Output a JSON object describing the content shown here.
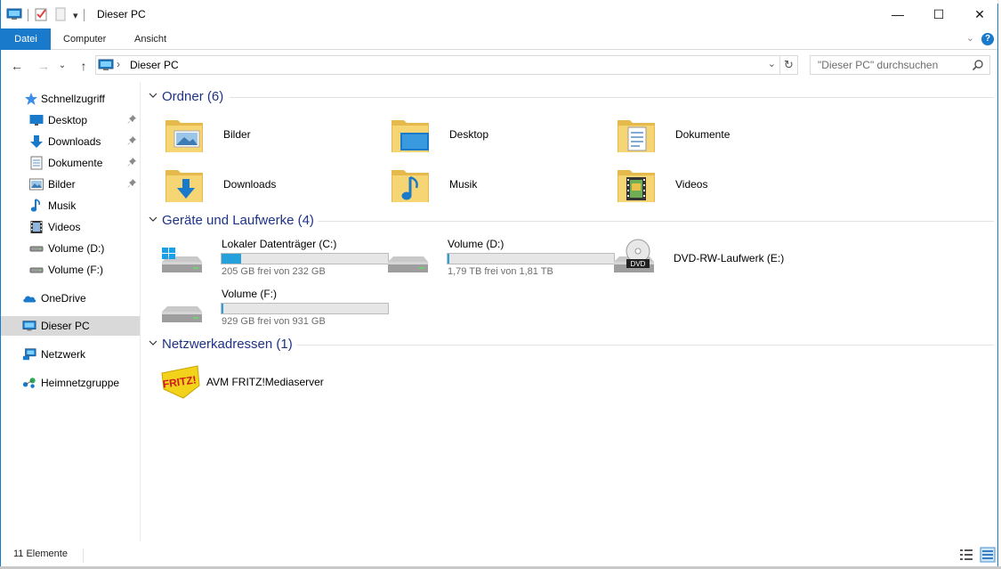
{
  "window": {
    "title": "Dieser PC",
    "minimize_glyph": "—",
    "maximize_glyph": "☐",
    "close_glyph": "✕"
  },
  "qat": {
    "dropdown_glyph": "▾",
    "icons": [
      "computer-icon",
      "properties-icon",
      "new-folder-icon",
      "customize-qat-icon"
    ]
  },
  "ribbon": {
    "tabs": [
      "Datei",
      "Computer",
      "Ansicht"
    ],
    "expand_glyph": "⌄",
    "help_glyph": "?"
  },
  "nav": {
    "back_glyph": "←",
    "forward_glyph": "→",
    "recent_glyph": "⌄",
    "up_glyph": "↑",
    "address_sep": "›",
    "address_crumb": "Dieser PC",
    "address_dropdown": "⌄",
    "refresh_glyph": "↻",
    "search_placeholder": "\"Dieser PC\" durchsuchen"
  },
  "sidebar": {
    "quick_access": "Schnellzugriff",
    "quick_items": [
      {
        "label": "Desktop",
        "icon": "desktop-icon",
        "pinned": true
      },
      {
        "label": "Downloads",
        "icon": "download-icon",
        "pinned": true
      },
      {
        "label": "Dokumente",
        "icon": "documents-icon",
        "pinned": true
      },
      {
        "label": "Bilder",
        "icon": "pictures-icon",
        "pinned": true
      },
      {
        "label": "Musik",
        "icon": "music-icon",
        "pinned": false
      },
      {
        "label": "Videos",
        "icon": "videos-icon",
        "pinned": false
      },
      {
        "label": "Volume (D:)",
        "icon": "drive-icon",
        "pinned": false
      },
      {
        "label": "Volume (F:)",
        "icon": "drive-icon",
        "pinned": false
      }
    ],
    "onedrive": "OneDrive",
    "this_pc": "Dieser PC",
    "network": "Netzwerk",
    "homegroup": "Heimnetzgruppe",
    "pin_glyph": "📌"
  },
  "content": {
    "folders_header": "Ordner (6)",
    "folders": [
      {
        "name": "Bilder",
        "icon": "pictures-folder-icon"
      },
      {
        "name": "Desktop",
        "icon": "desktop-folder-icon"
      },
      {
        "name": "Dokumente",
        "icon": "documents-folder-icon"
      },
      {
        "name": "Downloads",
        "icon": "downloads-folder-icon"
      },
      {
        "name": "Musik",
        "icon": "music-folder-icon"
      },
      {
        "name": "Videos",
        "icon": "videos-folder-icon"
      }
    ],
    "drives_header": "Geräte und Laufwerke (4)",
    "drives": [
      {
        "name": "Lokaler Datenträger (C:)",
        "free": "205 GB frei von 232 GB",
        "used_fraction": 0.116,
        "icon": "windows-drive-icon"
      },
      {
        "name": "Volume (D:)",
        "free": "1,79 TB frei von 1,81 TB",
        "used_fraction": 0.011,
        "icon": "hard-drive-icon"
      },
      {
        "name": "DVD-RW-Laufwerk (E:)",
        "icon": "dvd-drive-icon",
        "dvd_label": "DVD"
      },
      {
        "name": "Volume (F:)",
        "free": "929 GB frei von 931 GB",
        "used_fraction": 0.002,
        "icon": "hard-drive-icon"
      }
    ],
    "network_header": "Netzwerkadressen (1)",
    "network_items": [
      {
        "name": "AVM FRITZ!Mediaserver",
        "icon": "fritz-logo-icon",
        "logo_text": "FRITZ!"
      }
    ]
  },
  "status": {
    "count": "11 Elemente"
  },
  "colors": {
    "accent": "#1979ca",
    "group_title": "#1e3287",
    "bar_fill": "#26a0da",
    "folder": "#f5cf6a"
  }
}
